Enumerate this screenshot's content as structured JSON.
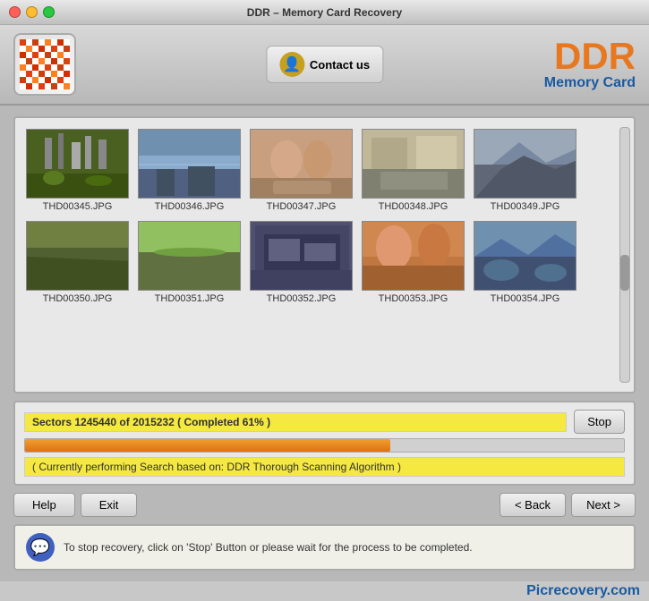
{
  "window": {
    "title": "DDR – Memory Card Recovery",
    "buttons": {
      "close": "close",
      "minimize": "minimize",
      "maximize": "maximize"
    }
  },
  "header": {
    "contact_label": "Contact us",
    "brand_ddr": "DDR",
    "brand_sub": "Memory Card"
  },
  "images": {
    "row1": [
      {
        "filename": "THD00345.JPG",
        "id": "345"
      },
      {
        "filename": "THD00346.JPG",
        "id": "346"
      },
      {
        "filename": "THD00347.JPG",
        "id": "347"
      },
      {
        "filename": "THD00348.JPG",
        "id": "348"
      },
      {
        "filename": "THD00349.JPG",
        "id": "349"
      }
    ],
    "row2": [
      {
        "filename": "THD00350.JPG",
        "id": "350"
      },
      {
        "filename": "THD00351.JPG",
        "id": "351"
      },
      {
        "filename": "THD00352.JPG",
        "id": "352"
      },
      {
        "filename": "THD00353.JPG",
        "id": "353"
      },
      {
        "filename": "THD00354.JPG",
        "id": "354"
      }
    ]
  },
  "progress": {
    "sectors_text": "Sectors 1245440 of 2015232  ( Completed 61% )",
    "fill_percent": 61,
    "algorithm_text": "( Currently performing Search based on: DDR Thorough Scanning Algorithm )",
    "stop_label": "Stop"
  },
  "navigation": {
    "help_label": "Help",
    "exit_label": "Exit",
    "back_label": "< Back",
    "next_label": "Next >"
  },
  "info_bar": {
    "message": "To stop recovery, click on 'Stop' Button or please wait for the process to be completed."
  },
  "footer": {
    "brand": "Picrecovery.com"
  }
}
